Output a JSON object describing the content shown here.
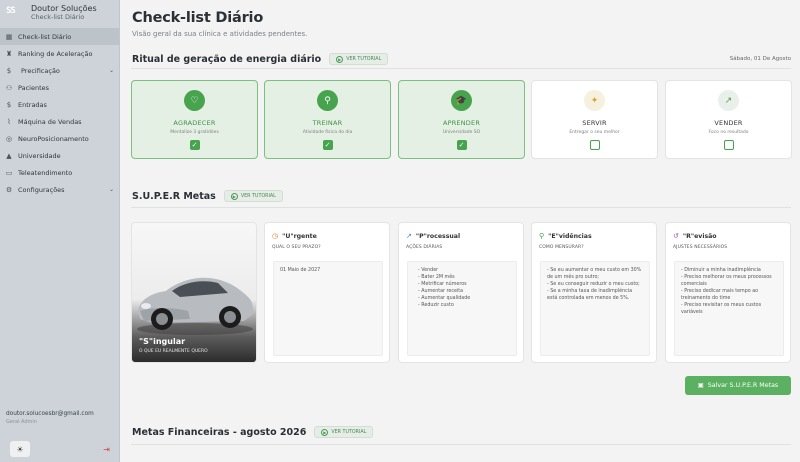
{
  "sidebar": {
    "brand_logo": "SS",
    "brand_name": "Doutor Soluções",
    "brand_sub": "Check-list Diário",
    "items": [
      {
        "label": "Check-list Diário",
        "icon": "checklist-icon",
        "glyph": "▦"
      },
      {
        "label": "Ranking de Aceleração",
        "icon": "ranking-icon",
        "glyph": "♜"
      },
      {
        "label": "Precificação",
        "icon": "dollar-icon",
        "glyph": "$"
      },
      {
        "label": "Pacientes",
        "icon": "users-icon",
        "glyph": "⚇"
      },
      {
        "label": "Entradas",
        "icon": "dollar-icon",
        "glyph": "$"
      },
      {
        "label": "Máquina de Vendas",
        "icon": "chart-icon",
        "glyph": "⌇"
      },
      {
        "label": "NeuroPosicionamento",
        "icon": "brain-icon",
        "glyph": "◎"
      },
      {
        "label": "Universidade",
        "icon": "graduation-icon",
        "glyph": "▲"
      },
      {
        "label": "Teleatendimento",
        "icon": "video-icon",
        "glyph": "▭"
      },
      {
        "label": "Configurações",
        "icon": "gear-icon",
        "glyph": "⚙"
      }
    ],
    "email": "doutor.solucoesbr@gmail.com",
    "role": "Geral Admin"
  },
  "page": {
    "title": "Check-list Diário",
    "subtitle": "Visão geral da sua clínica e atividades pendentes."
  },
  "ritual": {
    "title": "Ritual de geração de energia diário",
    "tutorial_label": "VER TUTORIAL",
    "date": "Sábado, 01 De Agosto",
    "cards": [
      {
        "title": "AGRADECER",
        "sub": "Mentalize 3 gratidões",
        "checked": true,
        "glyph": "♡"
      },
      {
        "title": "TREINAR",
        "sub": "Atividade física do dia",
        "checked": true,
        "glyph": "⚲"
      },
      {
        "title": "APRENDER",
        "sub": "Universidade SO",
        "checked": true,
        "glyph": "🎓"
      },
      {
        "title": "SERVIR",
        "sub": "Entregar o seu melhor",
        "checked": false,
        "glyph": "✦"
      },
      {
        "title": "VENDER",
        "sub": "Foco no resultado",
        "checked": false,
        "glyph": "↗"
      }
    ]
  },
  "super": {
    "title": "S.U.P.E.R Metas",
    "tutorial_label": "VER TUTORIAL",
    "car_title": "\"S\"ingular",
    "car_sub": "O QUE EU REALMENTE QUERO",
    "cards": [
      {
        "title": "\"U\"rgente",
        "sub": "QUAL O SEU PRAZO?",
        "text": "01 Maio de 2027",
        "glyph": "◷",
        "color": "#e07b2a"
      },
      {
        "title": "\"P\"rocessual",
        "sub": "AÇÕES DIÁRIAS",
        "text": "- Vender\n- Bater 2M mês\n- Metrificar números\n- Aumentar receita\n- Aumentar qualidade\n- Reduzir custo",
        "glyph": "↗",
        "color": "#3a8bd0"
      },
      {
        "title": "\"E\"vidências",
        "sub": "COMO MENSURAR?",
        "text": "- Se eu aumentar o meu custo em 30% de um mês pro outro;\n- Se eu conseguir reduzir o meu custo;\n- Se a minha taxa de inadimplência está controlada em menos de 5%.",
        "glyph": "⚲",
        "color": "#3aa35a"
      },
      {
        "title": "\"R\"evisão",
        "sub": "AJUSTES NECESSÁRIOS",
        "text": "- Diminuir a minha inadimplência\n- Preciso melhorar os meus processos comerciais\n- Preciso dedicar mais tempo ao treinamento do time\n- Preciso revisitar os meus custos variáveis",
        "glyph": "↺",
        "color": "#9b4fc4"
      }
    ],
    "save_label": "Salvar S.U.P.E.R Metas"
  },
  "financeiras": {
    "title": "Metas Financeiras - agosto 2026",
    "tutorial_label": "VER TUTORIAL"
  },
  "colors": {
    "accent": "#48a34f",
    "sidebar": "#cdd3d8",
    "background": "#f2f3f2"
  }
}
